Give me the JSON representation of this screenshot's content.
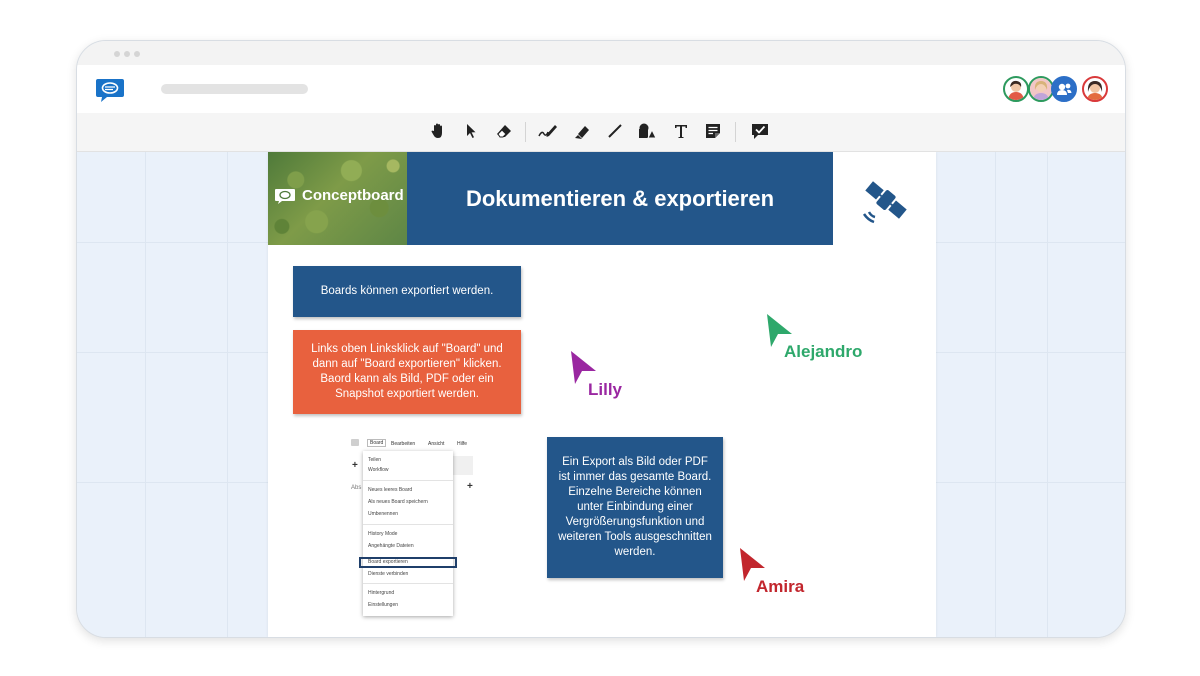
{
  "toolbar": {
    "tools": [
      "hand-icon",
      "select-arrow-icon",
      "eraser-icon",
      "pen-icon",
      "highlighter-icon",
      "line-icon",
      "shapes-icon",
      "text-icon",
      "sticky-note-icon",
      "review-icon"
    ]
  },
  "avatars": [
    "user-avatar-1",
    "user-avatar-2",
    "user-group-avatar",
    "user-avatar-3"
  ],
  "board": {
    "brand_name": "Conceptboard",
    "header_title": "Dokumentieren & exportieren",
    "notes": {
      "note1": "Boards können exportiert werden.",
      "note2": "Links oben Linksklick auf \"Board\" und dann auf \"Board exportieren\" klicken. Baord kann als Bild, PDF oder ein Snapshot exportiert werden.",
      "note3": "Ein Export als Bild oder PDF ist immer das gesamte Board. Einzelne Bereiche können unter Einbindung einer Vergrößerungsfunktion und weiteren Tools ausgeschnitten werden."
    },
    "cursors": [
      {
        "name": "Alejandro",
        "color": "#2ea86b"
      },
      {
        "name": "Lilly",
        "color": "#9a27a1"
      },
      {
        "name": "Amira",
        "color": "#c2262d"
      }
    ],
    "menu_screenshot": {
      "menubar": [
        "Board",
        "Bearbeiten",
        "Ansicht",
        "Hilfe"
      ],
      "items": [
        "Teilen",
        "Workflow",
        "Neues leeres Board",
        "Als neues Board speichern",
        "Umbenennen",
        "History Mode",
        "Angehängte Dateien",
        "Board exportieren",
        "Dienste verbinden",
        "Hintergrund",
        "Einstellungen"
      ],
      "side_label": "Abs"
    }
  },
  "colors": {
    "primary_blue": "#23568a",
    "orange": "#e8613e",
    "brand_blue": "#1a73c8"
  }
}
